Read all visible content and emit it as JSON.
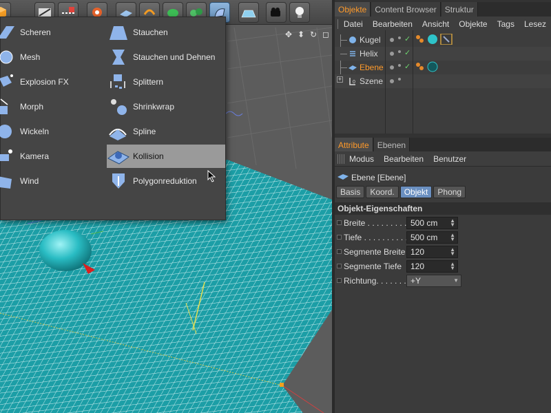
{
  "toolbar": {
    "buttons": [
      "cube-icon",
      "spline-pen-icon",
      "nurbs-icon",
      "array-icon",
      "deformer-bend-icon",
      "scene-floor-icon",
      "camera-icon",
      "light-bulb-icon"
    ]
  },
  "deformer_menu": {
    "left_items": [
      {
        "label": "Scheren",
        "icon": "shear-icon"
      },
      {
        "label": "Mesh",
        "icon": "mesh-deformer-icon"
      },
      {
        "label": "Explosion FX",
        "icon": "explosion-fx-icon"
      },
      {
        "label": "Morph",
        "icon": "morph-icon"
      },
      {
        "label": "Wickeln",
        "icon": "wrap-icon"
      },
      {
        "label": "Kamera",
        "icon": "camera-deformer-icon"
      },
      {
        "label": "Wind",
        "icon": "wind-icon"
      }
    ],
    "right_items": [
      {
        "label": "Stauchen",
        "icon": "squash-icon"
      },
      {
        "label": "Stauchen und Dehnen",
        "icon": "squash-stretch-icon"
      },
      {
        "label": "Splittern",
        "icon": "shatter-icon"
      },
      {
        "label": "Shrinkwrap",
        "icon": "shrinkwrap-icon"
      },
      {
        "label": "Spline",
        "icon": "spline-deformer-icon"
      },
      {
        "label": "Kollision",
        "icon": "collision-icon",
        "highlighted": true
      },
      {
        "label": "Polygonreduktion",
        "icon": "polygon-reduction-icon"
      }
    ]
  },
  "objects_panel": {
    "tabs": [
      "Objekte",
      "Content Browser",
      "Struktur"
    ],
    "active_tab": "Objekte",
    "menu": [
      "Datei",
      "Bearbeiten",
      "Ansicht",
      "Objekte",
      "Tags",
      "Lesez"
    ],
    "objects": [
      {
        "name": "Kugel",
        "selected": false
      },
      {
        "name": "Helix",
        "selected": false
      },
      {
        "name": "Ebene",
        "selected": true
      },
      {
        "name": "Szene",
        "selected": false
      }
    ]
  },
  "attribute_panel": {
    "tabs": [
      "Attribute",
      "Ebenen"
    ],
    "active_tab": "Attribute",
    "menu": [
      "Modus",
      "Bearbeiten",
      "Benutzer"
    ],
    "object_title": "Ebene [Ebene]",
    "subtabs": [
      "Basis",
      "Koord.",
      "Objekt",
      "Phong"
    ],
    "active_subtab": "Objekt",
    "section_title": "Objekt-Eigenschaften",
    "properties": [
      {
        "label": "Breite . . . . . . . . . .",
        "value": "500 cm"
      },
      {
        "label": "Tiefe . . . . . . . . . . .",
        "value": "500 cm"
      },
      {
        "label": "Segmente Breite",
        "value": "120"
      },
      {
        "label": "Segmente Tiefe",
        "value": "120"
      },
      {
        "label": "Richtung. . . . . . .",
        "value": "+Y"
      }
    ]
  },
  "colors": {
    "accent_orange": "#ff9a2a",
    "floor_cyan": "#1fa6ad",
    "sphere_cyan": "#2ec3c9",
    "highlight_gray": "#9a9a9a"
  }
}
